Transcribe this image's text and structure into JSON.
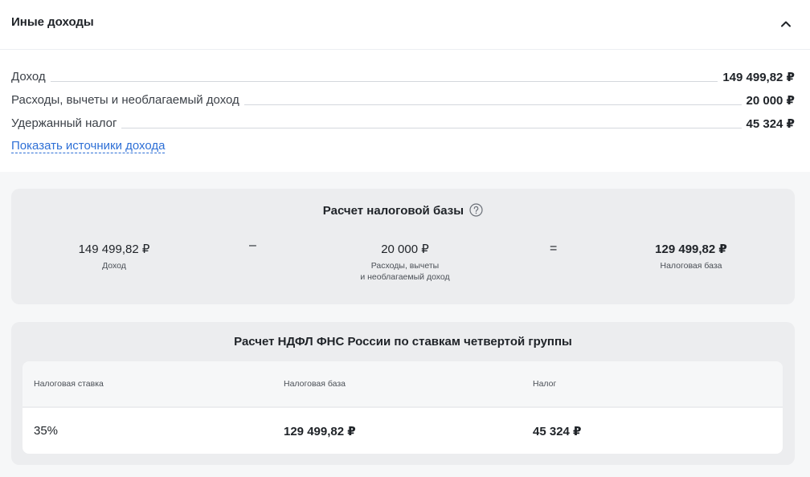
{
  "section": {
    "title": "Иные доходы",
    "collapse_icon": "chevron-up-icon"
  },
  "summary": {
    "rows": [
      {
        "label": "Доход",
        "value": "149 499,82 ₽"
      },
      {
        "label": "Расходы, вычеты и необлагаемый доход",
        "value": "20 000 ₽"
      },
      {
        "label": "Удержанный налог",
        "value": "45 324 ₽"
      }
    ],
    "sources_link": "Показать источники дохода"
  },
  "tax_base": {
    "title": "Расчет налоговой базы",
    "help_icon": "question-circle-icon",
    "income": {
      "value": "149 499,82 ₽",
      "caption": "Доход"
    },
    "minus": "–",
    "deductions": {
      "value": "20 000 ₽",
      "caption_line1": "Расходы, вычеты",
      "caption_line2": "и необлагаемый доход"
    },
    "equals": "=",
    "result": {
      "value": "129 499,82 ₽",
      "caption": "Налоговая база"
    }
  },
  "ndfl": {
    "title": "Расчет НДФЛ ФНС России по ставкам четвертой группы",
    "headers": [
      "Налоговая ставка",
      "Налоговая база",
      "Налог"
    ],
    "row": [
      "35%",
      "129 499,82 ₽",
      "45 324 ₽"
    ]
  }
}
